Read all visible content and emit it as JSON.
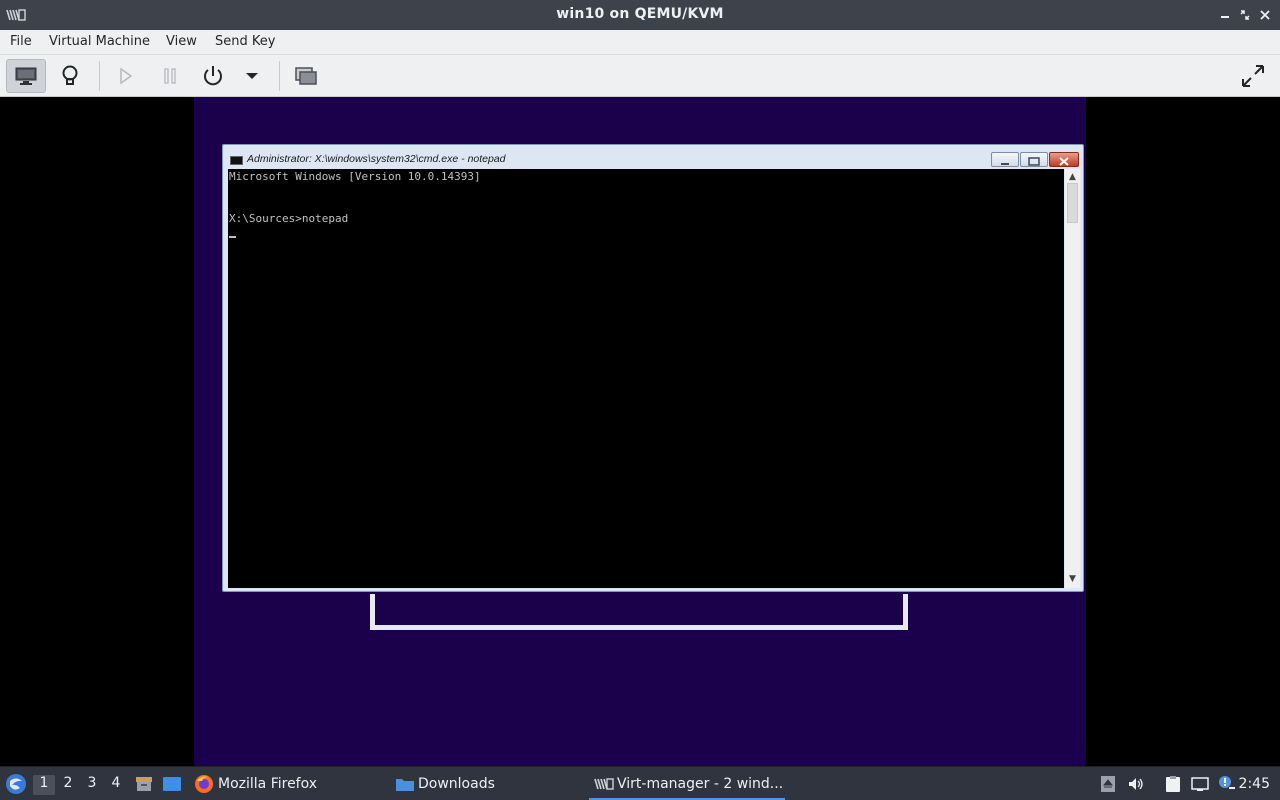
{
  "window": {
    "title": "win10 on QEMU/KVM"
  },
  "menubar": {
    "items": [
      "File",
      "Virtual Machine",
      "View",
      "Send Key"
    ]
  },
  "toolbar": {
    "buttons": [
      "monitor-icon",
      "lightbulb-icon",
      "play-icon",
      "pause-icon",
      "power-icon",
      "dropdown-arrow-icon",
      "screenshot-icon",
      "fullscreen-icon"
    ]
  },
  "guest": {
    "cmd_title": "Administrator: X:\\windows\\system32\\cmd.exe - notepad",
    "console_lines": [
      "Microsoft Windows [Version 10.0.14393]",
      "",
      "X:\\Sources>notepad"
    ],
    "background_color": "#1b004b"
  },
  "taskbar": {
    "workspaces": [
      "1",
      "2",
      "3",
      "4"
    ],
    "tasks": [
      {
        "label": "Mozilla Firefox"
      },
      {
        "label": "Downloads"
      },
      {
        "label": "Virt-manager - 2 wind..."
      }
    ],
    "clock": "2:45",
    "accent_color": "#5294e2"
  }
}
